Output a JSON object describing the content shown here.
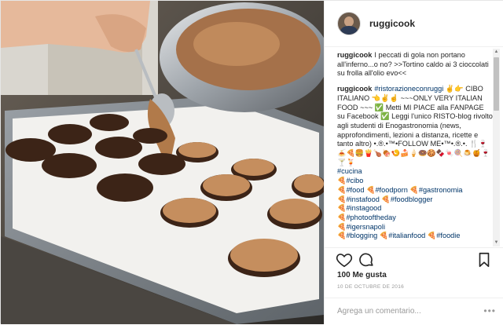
{
  "post": {
    "username": "ruggicook",
    "avatar_icon": "user-avatar",
    "photo_description": ""
  },
  "comments": [
    {
      "user": "ruggicook",
      "text": "I peccati di gola non portano all'inferno...o no? >>Tortino caldo ai 3 cioccolati su frolla all'olio evo<<"
    },
    {
      "user": "ruggicook",
      "tag": "#ristorazioneconruggi",
      "text": "✌️👉 CIBO ITALIANO 👈✌️☝️ ~~~ONLY VERY ITALIAN FOOD ~~~ ✅ Metti MI PIACE alla FANPAGE su Facebook ✅ Leggi l'unico RISTO-blog rivolto agli studenti di Enogastronomia (news, approfondimenti, lezioni a distanza, ricette e tanto altro) •.®.•™•FOLLOW ME•™•.®.•. 🍴🍷🍝🍕🍔🍟🍗🍖🍤🍰🍦🍩🍪🍫🍬🍭🍮🍯🍷🍸🍹"
    }
  ],
  "hashtags": [
    "#cucina",
    "🍕#cibo",
    "🍕#food",
    "🍕#foodporn",
    "🍕#gastronomia",
    "🍕#instafood",
    "🍕#foodblogger",
    "🍕#instagood",
    "🍕#photooftheday",
    "🍕#igersnapoli",
    "🍕#blogging",
    "🍕#italianfood",
    "🍕#foodie"
  ],
  "actions": {
    "like_icon": "heart-icon",
    "comment_icon": "comment-icon",
    "save_icon": "bookmark-icon"
  },
  "likes": "100 Me gusta",
  "date": "10 DE OCTUBRE DE 2016",
  "add_comment": {
    "placeholder": "Agrega un comentario..."
  },
  "more_icon": "more-dots-icon",
  "colors": {
    "text": "#262626",
    "hashtag": "#003569",
    "muted": "#999999",
    "border": "#efefef"
  }
}
